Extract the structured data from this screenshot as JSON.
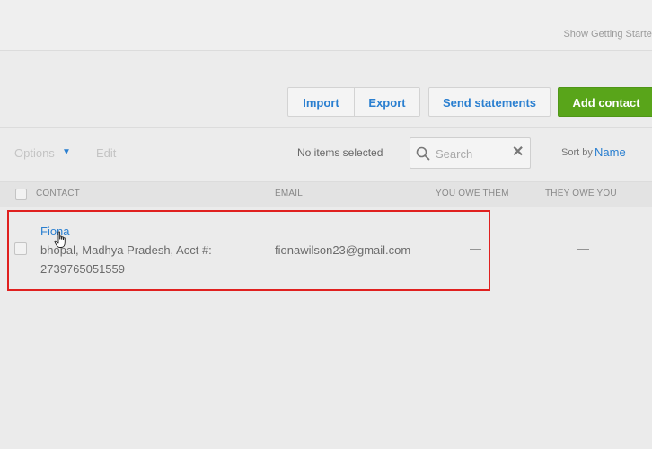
{
  "topbar": {
    "getting_started_label": "Show Getting Started"
  },
  "actions": {
    "import_label": "Import",
    "export_label": "Export",
    "send_statements_label": "Send statements",
    "add_contact_label": "Add contact",
    "add_contact_color": "#59a51a"
  },
  "toolbar": {
    "options_label": "Options",
    "edit_label": "Edit",
    "selection_status": "No items selected",
    "search": {
      "placeholder": "Search",
      "value": ""
    },
    "sort_label": "Sort by",
    "sort_value": "Name"
  },
  "table": {
    "columns": [
      "CONTACT",
      "EMAIL",
      "YOU OWE THEM",
      "THEY OWE YOU"
    ],
    "rows": [
      {
        "name": "Fiona",
        "address": "bhopal, Madhya Pradesh, Acct #: 2739765051559",
        "email": "fionawilson23@gmail.com",
        "you_owe_them": "—",
        "they_owe_you": "—"
      }
    ]
  },
  "colors": {
    "link": "#2a7fd0",
    "highlight": "#e0201f",
    "background": "#ebebeb"
  },
  "icons": {
    "search": "search-icon",
    "clear": "close-icon",
    "caret": "caret-down-icon",
    "cursor": "hand-pointer-icon"
  }
}
